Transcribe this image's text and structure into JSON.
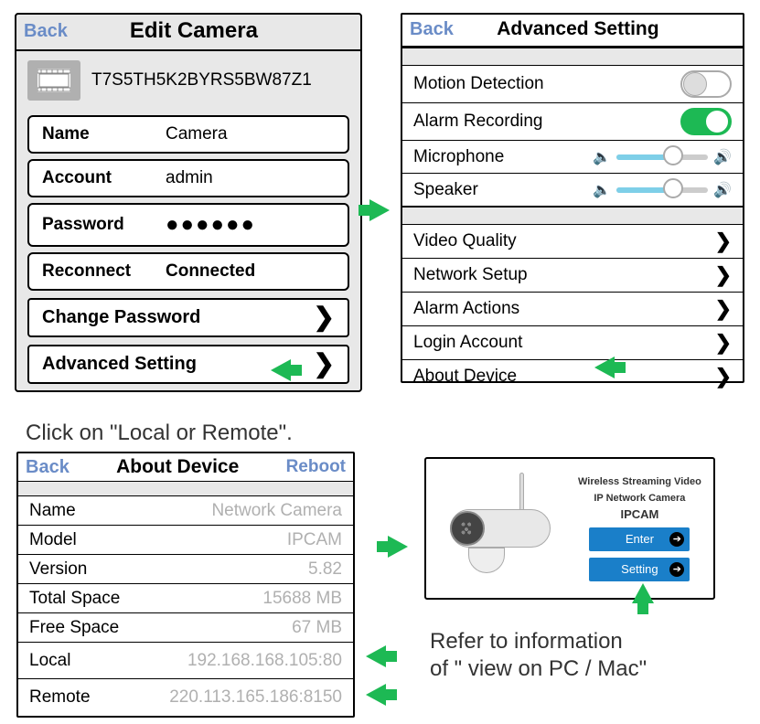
{
  "panel1": {
    "back": "Back",
    "title": "Edit Camera",
    "deviceId": "T7S5TH5K2BYRS5BW87Z1",
    "nameLabel": "Name",
    "nameValue": "Camera",
    "accountLabel": "Account",
    "accountValue": "admin",
    "passwordLabel": "Password",
    "passwordValue": "●●●●●●",
    "reconnectLabel": "Reconnect",
    "reconnectValue": "Connected",
    "changePassword": "Change Password",
    "advancedSetting": "Advanced Setting"
  },
  "panel2": {
    "back": "Back",
    "title": "Advanced Setting",
    "motionDetection": "Motion Detection",
    "alarmRecording": "Alarm Recording",
    "microphone": "Microphone",
    "speaker": "Speaker",
    "videoQuality": "Video Quality",
    "networkSetup": "Network Setup",
    "alarmActions": "Alarm Actions",
    "loginAccount": "Login Account",
    "aboutDevice": "About Device",
    "motionDetectionOn": false,
    "alarmRecordingOn": true,
    "micLevel": 0.62,
    "speakerLevel": 0.62
  },
  "instruction1": "Click on \"Local or Remote\".",
  "panel3": {
    "back": "Back",
    "title": "About Device",
    "reboot": "Reboot",
    "rows": {
      "nameLabel": "Name",
      "nameValue": "Network Camera",
      "modelLabel": "Model",
      "modelValue": "IPCAM",
      "versionLabel": "Version",
      "versionValue": "5.82",
      "totalSpaceLabel": "Total Space",
      "totalSpaceValue": "15688 MB",
      "freeSpaceLabel": "Free Space",
      "freeSpaceValue": "67 MB",
      "localLabel": "Local",
      "localValue": "192.168.168.105:80",
      "remoteLabel": "Remote",
      "remoteValue": "220.113.165.186:8150"
    }
  },
  "panel4": {
    "title1": "Wireless Streaming Video",
    "title2": "IP Network Camera",
    "model": "IPCAM",
    "enter": "Enter",
    "setting": "Setting"
  },
  "instruction2a": "Refer to information",
  "instruction2b": "of \" view on PC / Mac\""
}
